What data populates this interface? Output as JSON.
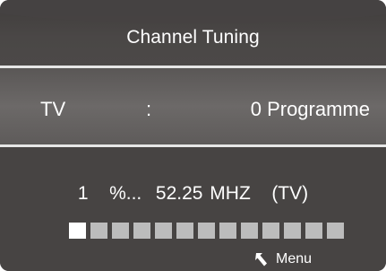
{
  "title": "Channel Tuning",
  "source": {
    "label": "TV",
    "separator": ":",
    "value": "0 Programme"
  },
  "scan": {
    "progress_text": "1",
    "percent_text": "%...",
    "frequency": "52.25 MHZ",
    "mode": "(TV)",
    "progress_percent": 1,
    "segments_total": 13,
    "segments_filled": 1
  },
  "footer": {
    "menu_label": "Menu",
    "menu_icon": "return-arrow-icon"
  },
  "colors": {
    "background": "#474443",
    "row_highlight": "#6c6968",
    "separator": "#e6e6e6",
    "segment_filled": "#ffffff",
    "segment_empty": "#bcbcbc",
    "text": "#ffffff"
  }
}
